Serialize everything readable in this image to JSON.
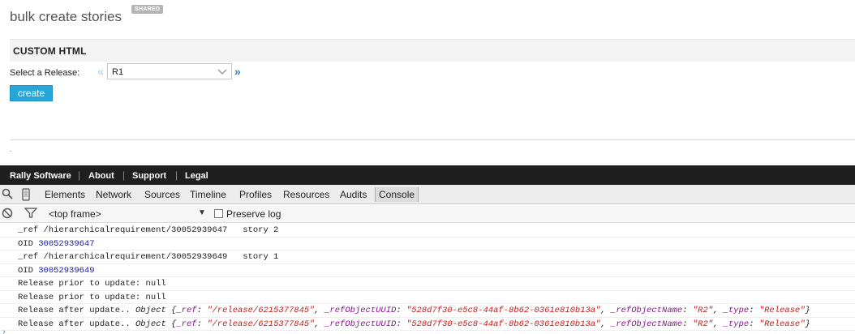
{
  "app": {
    "title": "bulk create stories",
    "badge": "SHARED"
  },
  "panel": {
    "title": "CUSTOM HTML",
    "release_label": "Select a Release:",
    "prev_glyph": "«",
    "next_glyph": "»",
    "release_value": "R1",
    "create_label": "create"
  },
  "footer": {
    "links": [
      "Rally Software",
      "About",
      "Support",
      "Legal"
    ],
    "separator": "|"
  },
  "devtools": {
    "tabs": [
      "Elements",
      "Network",
      "Sources",
      "Timeline",
      "Profiles",
      "Resources",
      "Audits",
      "Console"
    ],
    "active_tab": "Console",
    "frame": "<top frame>",
    "preserve_log": "Preserve log",
    "preserve_checked": false
  },
  "console": {
    "lines": [
      {
        "type": "ref",
        "text": "_ref /hierarchicalrequirement/30052939647   story 2"
      },
      {
        "type": "oid",
        "label": "OID ",
        "value": "30052939647"
      },
      {
        "type": "ref",
        "text": "_ref /hierarchicalrequirement/30052939649   story 1"
      },
      {
        "type": "oid",
        "label": "OID ",
        "value": "30052939649"
      },
      {
        "type": "plain",
        "text": "Release prior to update: null"
      },
      {
        "type": "plain",
        "text": "Release prior to update: null"
      },
      {
        "type": "object",
        "prefix": "Release after update.. ",
        "ref": "\"/release/6215377845\"",
        "uuid": "\"528d7f30-e5c8-44af-8b62-0361e810b13a\"",
        "name": "\"R2\"",
        "type_val": "\"Release\""
      },
      {
        "type": "object",
        "prefix": "Release after update.. ",
        "ref": "\"/release/6215377845\"",
        "uuid": "\"528d7f30-e5c8-44af-8b62-0361e810b13a\"",
        "name": "\"R2\"",
        "type_val": "\"Release\""
      }
    ],
    "object_label": "Object",
    "keys": {
      "ref": "_ref",
      "uuid": "_refObjectUUID",
      "name": "_refObjectName",
      "type": "_type"
    },
    "prompt": "›"
  }
}
